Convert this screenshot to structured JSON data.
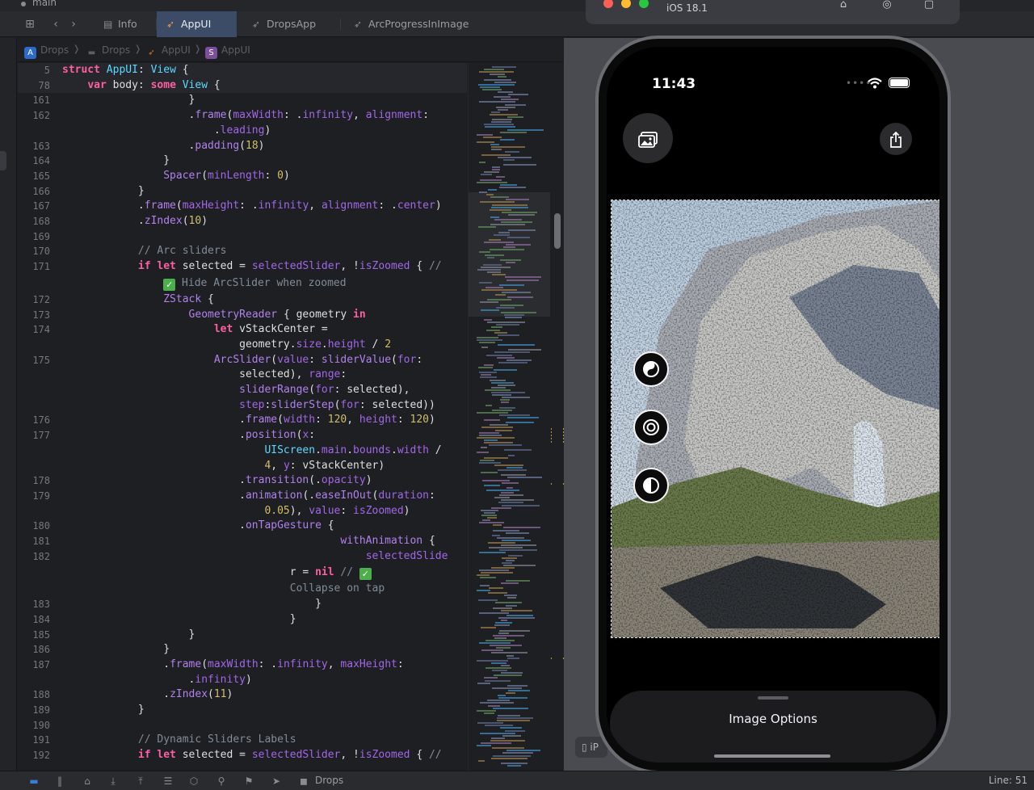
{
  "window": {
    "branch": "main"
  },
  "tabs": [
    {
      "label": "Info",
      "icon": "table-icon"
    },
    {
      "label": "AppUI",
      "icon": "swift-icon",
      "active": true
    },
    {
      "label": "DropsApp",
      "icon": "swift-icon"
    },
    {
      "label": "ArcProgressInImage",
      "icon": "swift-icon"
    }
  ],
  "breadcrumb": [
    "Drops",
    "Drops",
    "AppUI",
    "AppUI"
  ],
  "editor": {
    "sticky": [
      {
        "n": "5",
        "html": "<span class=\"kw\">struct</span> <span class=\"ty\">AppUI</span>: <span class=\"ty\">View</span> {"
      },
      {
        "n": "78",
        "html": "    <span class=\"kw\">var</span> body: <span class=\"kw\">some</span> <span class=\"ty\">View</span> {"
      }
    ],
    "lines": [
      {
        "n": "161",
        "html": "                    }"
      },
      {
        "n": "162",
        "html": "                    .<span class=\"me\">frame</span>(<span class=\"pr\">maxWidth</span>: .<span class=\"pr\">infinity</span>, <span class=\"pr\">alignment</span>:"
      },
      {
        "n": "",
        "html": "                        .<span class=\"pr\">leading</span>)"
      },
      {
        "n": "163",
        "html": "                    .<span class=\"me\">padding</span>(<span class=\"nu\">18</span>)"
      },
      {
        "n": "164",
        "html": "                }"
      },
      {
        "n": "165",
        "html": "                <span class=\"me\">Spacer</span>(<span class=\"pr\">minLength</span>: <span class=\"nu\">0</span>)"
      },
      {
        "n": "166",
        "html": "            }"
      },
      {
        "n": "167",
        "html": "            .<span class=\"me\">frame</span>(<span class=\"pr\">maxHeight</span>: .<span class=\"pr\">infinity</span>, <span class=\"pr\">alignment</span>: .<span class=\"pr\">center</span>)"
      },
      {
        "n": "168",
        "html": "            .<span class=\"me\">zIndex</span>(<span class=\"nu\">10</span>)"
      },
      {
        "n": "169",
        "html": ""
      },
      {
        "n": "170",
        "html": "            <span class=\"cm\">// Arc sliders</span>"
      },
      {
        "n": "171",
        "html": "            <span class=\"kw\">if</span> <span class=\"kw\">let</span> selected = <span class=\"pr\">selectedSlider</span>, !<span class=\"pr\">isZoomed</span> { <span class=\"cm\">//</span>"
      },
      {
        "n": "",
        "html": "                <span class=\"ok\">✓</span><span class=\"cm\"> Hide ArcSlider when zoomed</span>",
        "tall": true
      },
      {
        "n": "172",
        "html": "                <span class=\"me\">ZStack</span> {"
      },
      {
        "n": "173",
        "html": "                    <span class=\"me\">GeometryReader</span> { geometry <span class=\"kw\">in</span>"
      },
      {
        "n": "174",
        "html": "                        <span class=\"kw\">let</span> vStackCenter ="
      },
      {
        "n": "",
        "html": "                            geometry.<span class=\"pr\">size</span>.<span class=\"pr\">height</span> / <span class=\"nu\">2</span>"
      },
      {
        "n": "175",
        "html": "                        <span class=\"me\">ArcSlider</span>(<span class=\"pr\">value</span>: <span class=\"me\">sliderValue</span>(<span class=\"pr\">for</span>:"
      },
      {
        "n": "",
        "html": "                            selected), <span class=\"pr\">range</span>:"
      },
      {
        "n": "",
        "html": "                            <span class=\"me\">sliderRange</span>(<span class=\"pr\">for</span>: selected),"
      },
      {
        "n": "",
        "html": "                            <span class=\"pr\">step</span>:<span class=\"me\">sliderStep</span>(<span class=\"pr\">for</span>: selected))"
      },
      {
        "n": "176",
        "html": "                            .<span class=\"me\">frame</span>(<span class=\"pr\">width</span>: <span class=\"nu\">120</span>, <span class=\"pr\">height</span>: <span class=\"nu\">120</span>)"
      },
      {
        "n": "177",
        "html": "                            .<span class=\"me\">position</span>(<span class=\"pr\">x</span>:"
      },
      {
        "n": "",
        "html": "                                <span class=\"ty\">UIScreen</span>.<span class=\"pr\">main</span>.<span class=\"pr\">bounds</span>.<span class=\"pr\">width</span> /"
      },
      {
        "n": "",
        "html": "                                <span class=\"nu\">4</span>, <span class=\"pr\">y</span>: vStackCenter)"
      },
      {
        "n": "178",
        "html": "                            .<span class=\"me\">transition</span>(.<span class=\"pr\">opacity</span>)"
      },
      {
        "n": "179",
        "html": "                            .<span class=\"me\">animation</span>(.<span class=\"me\">easeInOut</span>(<span class=\"pr\">duration</span>:"
      },
      {
        "n": "",
        "html": "                                <span class=\"nu\">0.05</span>), <span class=\"pr\">value</span>: <span class=\"pr\">isZoomed</span>)"
      },
      {
        "n": "180",
        "html": "                            .<span class=\"me\">onTapGesture</span> {"
      },
      {
        "n": "181",
        "html": "                                            <span class=\"me\">withAnimation</span> {"
      },
      {
        "n": "182",
        "html": "                                                <span class=\"pr\">selectedSlide</span>"
      },
      {
        "n": "",
        "html": "                                    r = <span class=\"kw\">nil</span> <span class=\"cm\">//</span> <span class=\"ok\">✓</span>",
        "tall": true
      },
      {
        "n": "",
        "html": "                                    <span class=\"cm\">Collapse on tap</span>"
      },
      {
        "n": "183",
        "html": "                                        }"
      },
      {
        "n": "184",
        "html": "                                    }"
      },
      {
        "n": "185",
        "html": "                    }"
      },
      {
        "n": "186",
        "html": "                }"
      },
      {
        "n": "187",
        "html": "                .<span class=\"me\">frame</span>(<span class=\"pr\">maxWidth</span>: .<span class=\"pr\">infinity</span>, <span class=\"pr\">maxHeight</span>:"
      },
      {
        "n": "",
        "html": "                    .<span class=\"pr\">infinity</span>)"
      },
      {
        "n": "188",
        "html": "                .<span class=\"me\">zIndex</span>(<span class=\"nu\">11</span>)"
      },
      {
        "n": "189",
        "html": "            }"
      },
      {
        "n": "190",
        "html": ""
      },
      {
        "n": "191",
        "html": "            <span class=\"cm\">// Dynamic Sliders Labels</span>"
      },
      {
        "n": "192",
        "html": "            <span class=\"kw\">if</span> <span class=\"kw\">let</span> selected = <span class=\"pr\">selectedSlider</span>, !<span class=\"pr\">isZoomed</span> { <span class=\"cm\">//</span>"
      }
    ]
  },
  "simulator": {
    "os_label": "iOS 18.1",
    "preview_chip": "iP"
  },
  "phone": {
    "time": "11:43",
    "sheet_title": "Image Options"
  },
  "statusbar": {
    "scheme": "Drops",
    "cursor": "Line: 51"
  }
}
